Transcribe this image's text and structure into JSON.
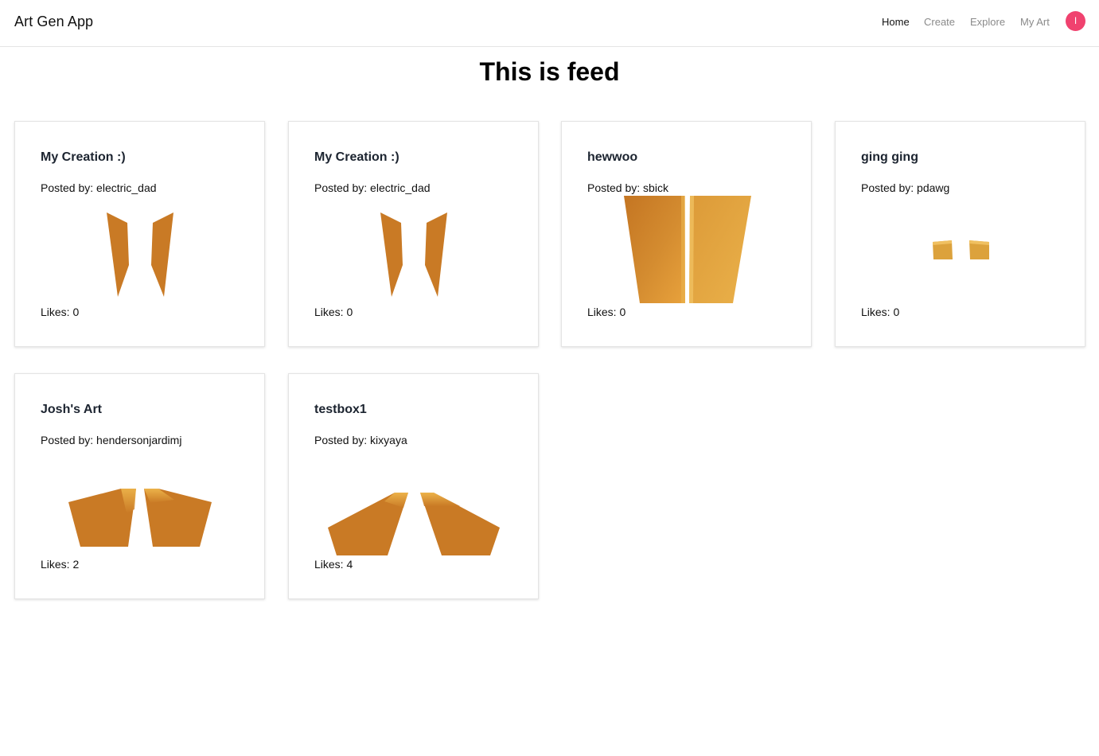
{
  "app": {
    "title": "Art Gen App"
  },
  "nav": {
    "items": [
      "Home",
      "Create",
      "Explore",
      "My Art"
    ],
    "active": "Home",
    "avatar_initial": "I",
    "avatar_color": "#f0426f"
  },
  "page": {
    "title": "This is feed"
  },
  "colors": {
    "art_orange": "#c97a25",
    "art_highlight": "#eab14a"
  },
  "posts": [
    {
      "title": "My Creation :)",
      "author_line": "Posted by: electric_dad",
      "likes_line": "Likes: 0"
    },
    {
      "title": "My Creation :)",
      "author_line": "Posted by: electric_dad",
      "likes_line": "Likes: 0"
    },
    {
      "title": "hewwoo",
      "author_line": "Posted by: sbick",
      "likes_line": "Likes: 0"
    },
    {
      "title": "ging ging",
      "author_line": "Posted by: pdawg",
      "likes_line": "Likes: 0"
    },
    {
      "title": "Josh's Art",
      "author_line": "Posted by: hendersonjardimj",
      "likes_line": "Likes: 2"
    },
    {
      "title": "testbox1",
      "author_line": "Posted by: kixyaya",
      "likes_line": "Likes: 4"
    }
  ]
}
